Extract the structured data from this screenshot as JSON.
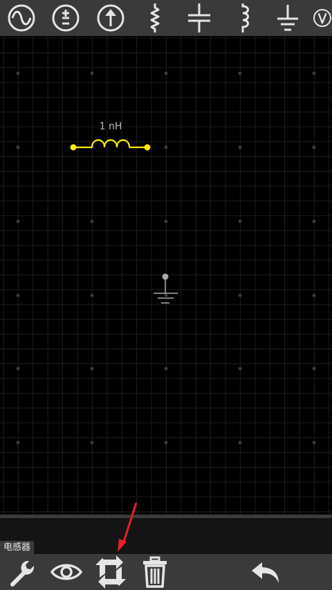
{
  "toolbar": {
    "items": [
      {
        "icon": "ac-source-icon"
      },
      {
        "icon": "dc-source-icon"
      },
      {
        "icon": "current-source-icon"
      },
      {
        "icon": "resistor-icon"
      },
      {
        "icon": "capacitor-icon"
      },
      {
        "icon": "inductor-icon"
      },
      {
        "icon": "ground-icon"
      },
      {
        "icon": "voltmeter-icon"
      }
    ]
  },
  "circuit": {
    "inductor": {
      "label": "1 nH",
      "color": "#ffee00"
    },
    "ground": {
      "color": "#aaaaaa"
    }
  },
  "selection_hint": "电感器",
  "bottom_toolbar": {
    "items": [
      {
        "icon": "wrench-icon"
      },
      {
        "icon": "eye-icon"
      },
      {
        "icon": "rotate-icon"
      },
      {
        "icon": "trash-icon"
      },
      {
        "icon": "undo-icon"
      }
    ]
  },
  "colors": {
    "toolbar_bg": "#3a3a3a",
    "icon": "#e6e6e6",
    "grid": "#1e1e1e",
    "annotation_arrow": "#e8202a"
  }
}
